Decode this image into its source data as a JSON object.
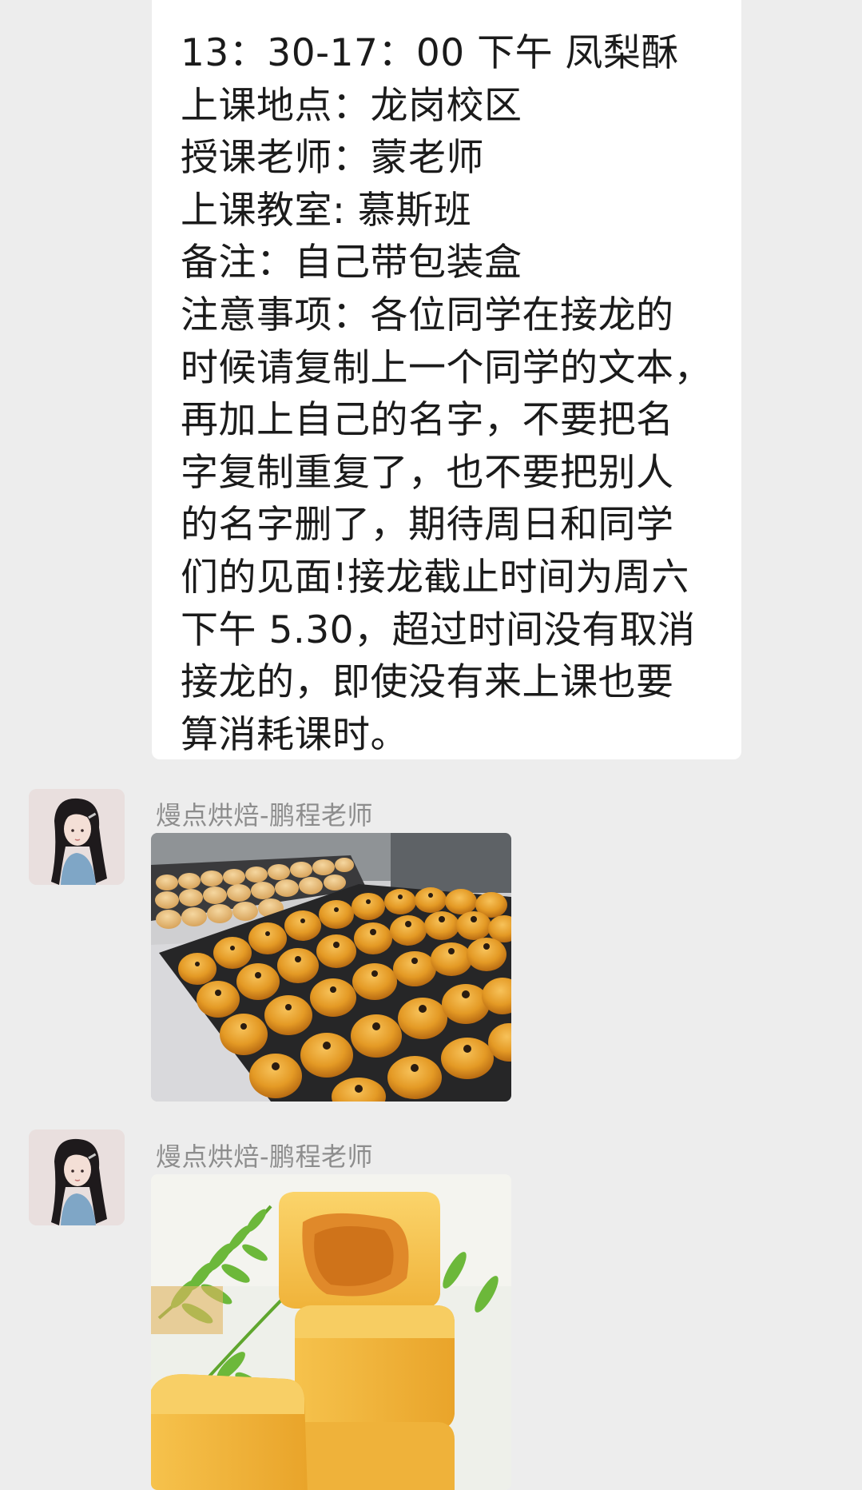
{
  "chat": {
    "text_message": {
      "lines": [
        "13：30-17：00 下午  凤梨酥",
        "上课地点：龙岗校区",
        "授课老师：蒙老师",
        "上课教室: 慕斯班",
        "备注：自己带包装盒",
        "注意事项：各位同学在接龙的",
        "时候请复制上一个同学的文本，",
        "再加上自己的名字，不要把名",
        "字复制重复了，也不要把别人",
        "的名字删了，期待周日和同学",
        "们的见面!接龙截止时间为周六",
        "下午 5.30，超过时间没有取消",
        "接龙的，即使没有来上课也要",
        "算消耗课时。"
      ]
    },
    "messages": [
      {
        "sender": "熳点烘焙-鹏程老师",
        "avatar_icon": "girl-portrait-avatar",
        "image_icon": "egg-yolk-pastry-tray-photo"
      },
      {
        "sender": "熳点烘焙-鹏程老师",
        "avatar_icon": "girl-portrait-avatar",
        "image_icon": "pineapple-cake-photo"
      }
    ]
  },
  "colors": {
    "background": "#ededed",
    "bubble": "#ffffff",
    "text": "#1b1b1b",
    "sender_name": "#8d8d8d"
  }
}
